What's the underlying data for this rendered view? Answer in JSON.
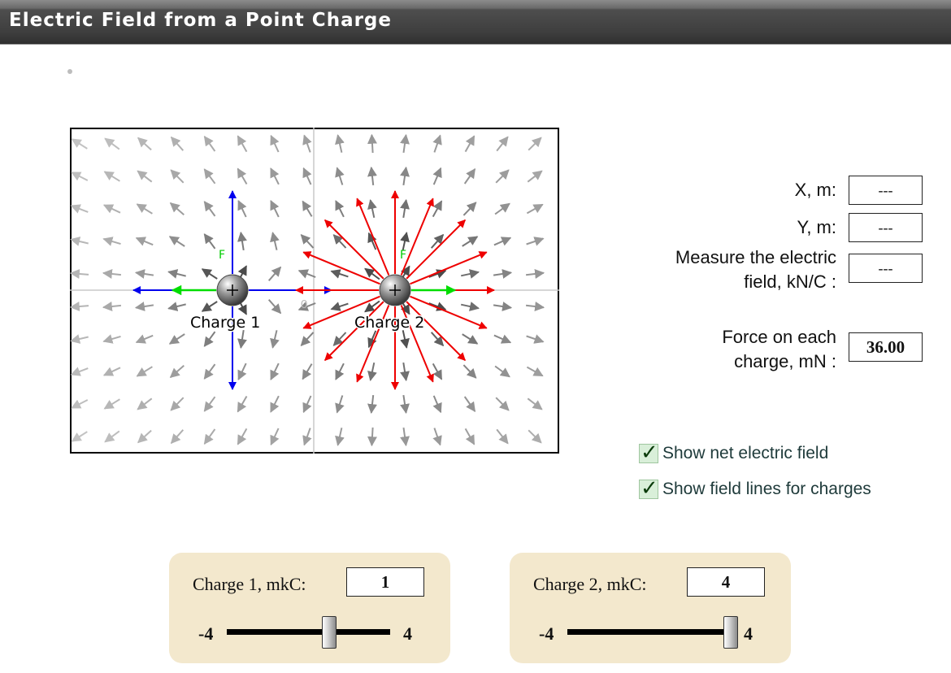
{
  "app": {
    "title": "Electric Field from a Point Charge"
  },
  "field": {
    "origin_label": "0",
    "charge1": {
      "label": "Charge 1",
      "force_label": "F",
      "value": 1,
      "range": [
        -4,
        4
      ]
    },
    "charge2": {
      "label": "Charge 2",
      "force_label": "F",
      "value": 4,
      "range": [
        -4,
        4
      ]
    },
    "colors": {
      "net_field_arrow": "#5a5a5a",
      "charge1_field_lines": "#0000ee",
      "charge2_field_lines": "#ee0000",
      "force_arrow": "#00dd00"
    }
  },
  "readouts": {
    "x_label": "X, m:",
    "x_value": "---",
    "y_label": "Y, m:",
    "y_value": "---",
    "e_label_line1": "Measure the electric",
    "e_label_line2": "field, kN/C :",
    "e_value": "---",
    "force_label_line1": "Force on each",
    "force_label_line2": "charge, mN :",
    "force_value": "36.00"
  },
  "options": {
    "show_net_field": {
      "label": "Show net electric field",
      "checked": true,
      "mark": "✓"
    },
    "show_field_lines": {
      "label": "Show field lines for charges",
      "checked": true,
      "mark": "✓"
    }
  },
  "controls": {
    "charge1": {
      "label": "Charge 1, mkC:",
      "value": "1",
      "min_label": "-4",
      "max_label": "4"
    },
    "charge2": {
      "label": "Charge 2, mkC:",
      "value": "4",
      "min_label": "-4",
      "max_label": "4"
    }
  }
}
